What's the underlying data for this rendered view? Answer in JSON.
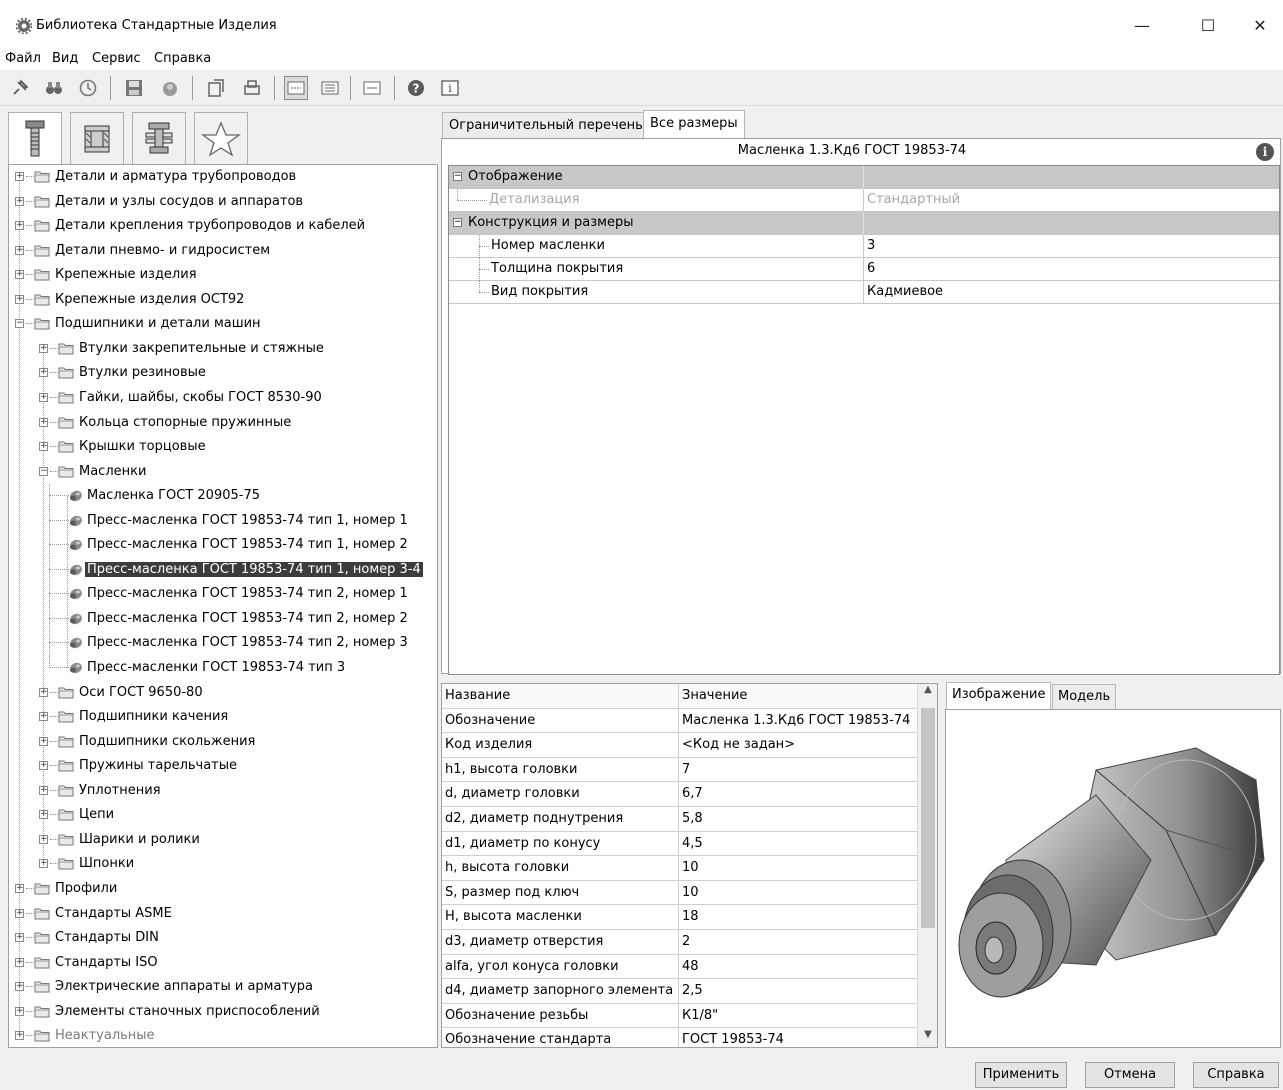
{
  "window": {
    "title": "Библиотека Стандартные Изделия",
    "minimize": "—",
    "maximize": "☐",
    "close": "✕"
  },
  "menu": [
    "Файл",
    "Вид",
    "Сервис",
    "Справка"
  ],
  "tree": {
    "items": [
      {
        "label": "Детали и арматура трубопроводов",
        "level": 0,
        "type": "folder",
        "expand": "+"
      },
      {
        "label": "Детали и узлы сосудов и аппаратов",
        "level": 0,
        "type": "folder",
        "expand": "+"
      },
      {
        "label": "Детали крепления трубопроводов и кабелей",
        "level": 0,
        "type": "folder",
        "expand": "+"
      },
      {
        "label": "Детали пневмо- и гидросистем",
        "level": 0,
        "type": "folder",
        "expand": "+"
      },
      {
        "label": "Крепежные изделия",
        "level": 0,
        "type": "folder",
        "expand": "+"
      },
      {
        "label": "Крепежные изделия ОСТ92",
        "level": 0,
        "type": "folder",
        "expand": "+"
      },
      {
        "label": "Подшипники и детали машин",
        "level": 0,
        "type": "folder",
        "expand": "−"
      },
      {
        "label": "Втулки закрепительные и стяжные",
        "level": 1,
        "type": "folder",
        "expand": "+"
      },
      {
        "label": "Втулки резиновые",
        "level": 1,
        "type": "folder",
        "expand": "+"
      },
      {
        "label": "Гайки, шайбы, скобы ГОСТ 8530-90",
        "level": 1,
        "type": "folder",
        "expand": "+"
      },
      {
        "label": "Кольца стопорные пружинные",
        "level": 1,
        "type": "folder",
        "expand": "+"
      },
      {
        "label": "Крышки торцовые",
        "level": 1,
        "type": "folder",
        "expand": "+"
      },
      {
        "label": "Масленки",
        "level": 1,
        "type": "folder",
        "expand": "−"
      },
      {
        "label": "Масленка ГОСТ 20905-75",
        "level": 2,
        "type": "item"
      },
      {
        "label": "Пресс-масленка ГОСТ 19853-74 тип 1, номер 1",
        "level": 2,
        "type": "item"
      },
      {
        "label": "Пресс-масленка ГОСТ 19853-74 тип 1, номер 2",
        "level": 2,
        "type": "item"
      },
      {
        "label": "Пресс-масленка ГОСТ 19853-74 тип 1, номер 3-4",
        "level": 2,
        "type": "item",
        "selected": true
      },
      {
        "label": "Пресс-масленка ГОСТ 19853-74 тип 2, номер 1",
        "level": 2,
        "type": "item"
      },
      {
        "label": "Пресс-масленка ГОСТ 19853-74 тип 2, номер 2",
        "level": 2,
        "type": "item"
      },
      {
        "label": "Пресс-масленка ГОСТ 19853-74 тип 2, номер 3",
        "level": 2,
        "type": "item"
      },
      {
        "label": "Пресс-масленки ГОСТ 19853-74 тип 3",
        "level": 2,
        "type": "item"
      },
      {
        "label": "Оси ГОСТ 9650-80",
        "level": 1,
        "type": "folder",
        "expand": "+"
      },
      {
        "label": "Подшипники качения",
        "level": 1,
        "type": "folder",
        "expand": "+"
      },
      {
        "label": "Подшипники скольжения",
        "level": 1,
        "type": "folder",
        "expand": "+"
      },
      {
        "label": "Пружины тарельчатые",
        "level": 1,
        "type": "folder",
        "expand": "+"
      },
      {
        "label": "Уплотнения",
        "level": 1,
        "type": "folder",
        "expand": "+"
      },
      {
        "label": "Цепи",
        "level": 1,
        "type": "folder",
        "expand": "+"
      },
      {
        "label": "Шарики и ролики",
        "level": 1,
        "type": "folder",
        "expand": "+"
      },
      {
        "label": "Шпонки",
        "level": 1,
        "type": "folder",
        "expand": "+"
      },
      {
        "label": "Профили",
        "level": 0,
        "type": "folder",
        "expand": "+"
      },
      {
        "label": "Стандарты ASME",
        "level": 0,
        "type": "folder",
        "expand": "+"
      },
      {
        "label": "Стандарты DIN",
        "level": 0,
        "type": "folder",
        "expand": "+"
      },
      {
        "label": "Стандарты ISO",
        "level": 0,
        "type": "folder",
        "expand": "+"
      },
      {
        "label": "Электрические аппараты и арматура",
        "level": 0,
        "type": "folder",
        "expand": "+"
      },
      {
        "label": "Элементы станочных приспособлений",
        "level": 0,
        "type": "folder",
        "expand": "+"
      },
      {
        "label": "Неактуальные",
        "level": 0,
        "type": "folder",
        "expand": "+",
        "muted": true
      }
    ]
  },
  "tabs": {
    "restrictive": "Ограничительный перечень",
    "all_sizes": "Все размеры"
  },
  "props": {
    "title": "Масленка 1.3.Кд6 ГОСТ 19853-74",
    "info": "i",
    "group_display": "Отображение",
    "detail_name": "Детализация",
    "detail_value": "Стандартный",
    "group_construct": "Конструкция и размеры",
    "rows": [
      {
        "name": "Номер масленки",
        "value": "3"
      },
      {
        "name": "Толщина покрытия",
        "value": "6"
      },
      {
        "name": "Вид покрытия",
        "value": "Кадмиевое"
      }
    ]
  },
  "table": {
    "headers": [
      "Название",
      "Значение"
    ],
    "rows": [
      [
        "Обозначение",
        "Масленка 1.3.Кд6 ГОСТ 19853-74"
      ],
      [
        "Код изделия",
        "<Код не задан>"
      ],
      [
        "h1, высота головки",
        "7"
      ],
      [
        "d, диаметр головки",
        "6,7"
      ],
      [
        "d2, диаметр поднутрения",
        "5,8"
      ],
      [
        "d1, диаметр по конусу",
        "4,5"
      ],
      [
        "h, высота головки",
        "10"
      ],
      [
        "S, размер под ключ",
        "10"
      ],
      [
        "H, высота масленки",
        "18"
      ],
      [
        "d3, диаметр отверстия",
        "2"
      ],
      [
        "alfa, угол конуса головки",
        "48"
      ],
      [
        "d4, диаметр запорного элемента",
        "2,5"
      ],
      [
        "Обозначение резьбы",
        "К1/8\""
      ],
      [
        "Обозначение стандарта",
        "ГОСТ 19853-74"
      ]
    ],
    "scroll_up": "▲",
    "scroll_down": "▼"
  },
  "image_tabs": {
    "image": "Изображение",
    "model": "Модель"
  },
  "buttons": {
    "apply": "Применить",
    "cancel": "Отмена",
    "help": "Справка"
  },
  "colors": {
    "selection": "#3c3c3c",
    "group_row": "#c8c8c8",
    "window_bg": "#f0f0f0"
  }
}
